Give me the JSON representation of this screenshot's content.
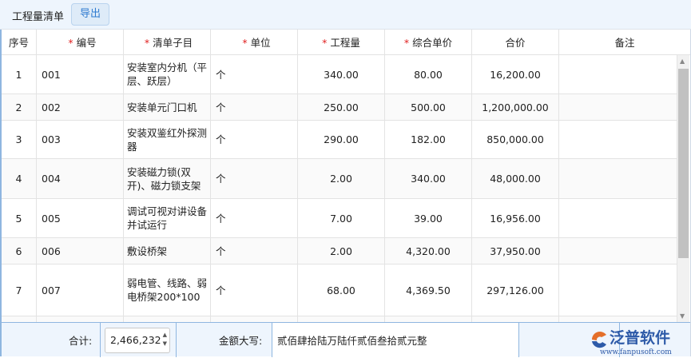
{
  "toolbar": {
    "title": "工程量清单",
    "export_label": "导出"
  },
  "columns": [
    {
      "label": "序号",
      "required": false
    },
    {
      "label": "编号",
      "required": true
    },
    {
      "label": "清单子目",
      "required": true
    },
    {
      "label": "单位",
      "required": true
    },
    {
      "label": "工程量",
      "required": true
    },
    {
      "label": "综合单价",
      "required": true
    },
    {
      "label": "合价",
      "required": false
    },
    {
      "label": "备注",
      "required": false
    }
  ],
  "required_mark": "*",
  "rows": [
    {
      "no": "1",
      "code": "001",
      "item": "安装室内分机（平层、跃层）",
      "unit": "个",
      "qty": "340.00",
      "price": "80.00",
      "total": "16,200.00",
      "note": ""
    },
    {
      "no": "2",
      "code": "002",
      "item": "安装单元门口机",
      "unit": "个",
      "qty": "250.00",
      "price": "500.00",
      "total": "1,200,000.00",
      "note": ""
    },
    {
      "no": "3",
      "code": "003",
      "item": "安装双鉴红外探测器",
      "unit": "个",
      "qty": "290.00",
      "price": "182.00",
      "total": "850,000.00",
      "note": ""
    },
    {
      "no": "4",
      "code": "004",
      "item": "安装磁力锁(双开)、磁力锁支架",
      "unit": "个",
      "qty": "2.00",
      "price": "340.00",
      "total": "48,000.00",
      "note": ""
    },
    {
      "no": "5",
      "code": "005",
      "item": "调试可视对讲设备并试运行",
      "unit": "个",
      "qty": "7.00",
      "price": "39.00",
      "total": "16,956.00",
      "note": ""
    },
    {
      "no": "6",
      "code": "006",
      "item": "敷设桥架",
      "unit": "个",
      "qty": "2.00",
      "price": "4,320.00",
      "total": "37,950.00",
      "note": ""
    },
    {
      "no": "7",
      "code": "007",
      "item": "弱电管、线路、弱电桥架200*100",
      "unit": "个",
      "qty": "68.00",
      "price": "4,369.50",
      "total": "297,126.00",
      "note": ""
    }
  ],
  "footer": {
    "total_label": "合计:",
    "total_value": "2,466,232",
    "uppercase_label": "金额大写:",
    "uppercase_value": "贰佰肆拾陆万陆仟贰佰叁拾贰元整"
  },
  "logo": {
    "name": "泛普软件",
    "url": "www.fanpusoft.com"
  }
}
